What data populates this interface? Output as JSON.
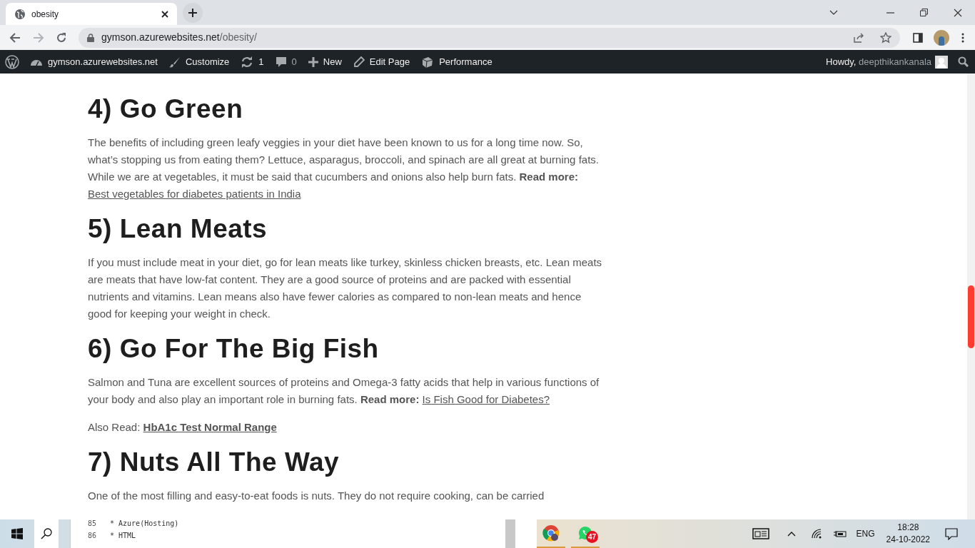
{
  "browser": {
    "tab": {
      "title": "obesity"
    },
    "url": {
      "host": "gymson.azurewebsites.net",
      "path": "/obesity/"
    }
  },
  "admin_bar": {
    "items": [
      {
        "kind": "wp-logo"
      },
      {
        "kind": "site",
        "label": "gymson.azurewebsites.net"
      },
      {
        "kind": "customize",
        "label": "Customize"
      },
      {
        "kind": "updates",
        "label": "1"
      },
      {
        "kind": "comments",
        "label": "0"
      },
      {
        "kind": "new",
        "label": "New"
      },
      {
        "kind": "edit",
        "label": "Edit Page"
      },
      {
        "kind": "performance",
        "label": "Performance"
      }
    ],
    "greeting": "Howdy,",
    "user": "deepthikankanala"
  },
  "article": [
    {
      "kind": "heading",
      "text": "4) Go Green"
    },
    {
      "kind": "paragraph",
      "segments": [
        {
          "kind": "text",
          "text": "The benefits of including green leafy veggies in your diet have been known to us for a long time now. So, what’s stopping us from eating them? Lettuce, asparagus, broccoli, and spinach are all great at burning fats. While we are at vegetables, it must be said that cucumbers and onions also help burn fats. "
        },
        {
          "kind": "bold",
          "text": "Read more: "
        },
        {
          "kind": "link",
          "text": "Best vegetables for diabetes patients in India"
        }
      ]
    },
    {
      "kind": "heading",
      "text": "5) Lean Meats"
    },
    {
      "kind": "paragraph",
      "segments": [
        {
          "kind": "text",
          "text": "If you must include meat in your diet, go for lean meats like turkey, skinless chicken breasts, etc. Lean meats are meats that have low-fat content. They are a good source of proteins and are packed with essential nutrients and vitamins. Lean means also have fewer calories as compared to non-lean meats and hence good for keeping your weight in check."
        }
      ]
    },
    {
      "kind": "heading",
      "text": "6) Go For The Big Fish"
    },
    {
      "kind": "paragraph",
      "segments": [
        {
          "kind": "text",
          "text": "Salmon and Tuna are excellent sources of proteins and Omega-3 fatty acids that help in various functions of your body and also play an important role in burning fats. "
        },
        {
          "kind": "bold",
          "text": "Read more: "
        },
        {
          "kind": "link",
          "text": "Is Fish Good for Diabetes?"
        }
      ]
    },
    {
      "kind": "paragraph",
      "segments": [
        {
          "kind": "text",
          "text": "Also Read: "
        },
        {
          "kind": "bold-link",
          "text": "HbA1c Test Normal Range"
        }
      ]
    },
    {
      "kind": "heading",
      "text": "7) Nuts All The Way"
    },
    {
      "kind": "paragraph",
      "segments": [
        {
          "kind": "text",
          "text": "One of the most filling and easy-to-eat foods is nuts. They do not require cooking, can be carried"
        }
      ]
    }
  ],
  "taskbar": {
    "code_lines": [
      {
        "number": "85",
        "text": "* Azure(Hosting)"
      },
      {
        "number": "86",
        "text": "* HTML"
      }
    ],
    "whatsapp_badge": "47",
    "language": "ENG",
    "time": "18:28",
    "date": "24-10-2022"
  }
}
